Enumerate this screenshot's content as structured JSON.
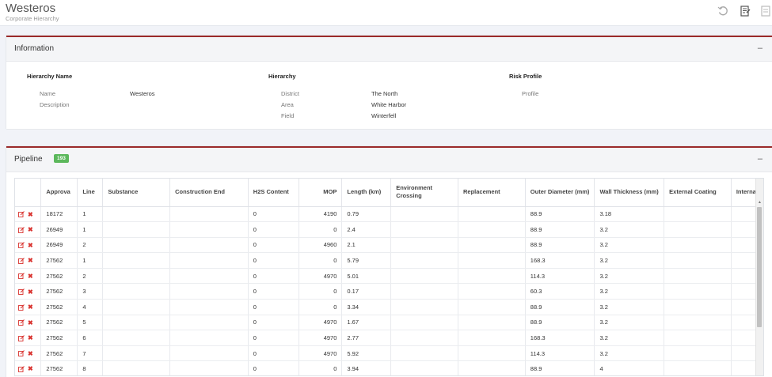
{
  "header": {
    "title": "Westeros",
    "subtitle": "Corporate Hierarchy",
    "icons": [
      "undo-icon",
      "report-icon",
      "export-icon"
    ]
  },
  "info": {
    "title": "Information",
    "collapse": "–",
    "hierarchy_name": {
      "heading": "Hierarchy Name",
      "name_label": "Name",
      "name_value": "Westeros",
      "description_label": "Description"
    },
    "hierarchy": {
      "heading": "Hierarchy",
      "district_label": "District",
      "district_value": "The North",
      "area_label": "Area",
      "area_value": "White Harbor",
      "field_label": "Field",
      "field_value": "Winterfell"
    },
    "risk": {
      "heading": "Risk Profile",
      "profile_label": "Profile"
    }
  },
  "pipeline": {
    "title": "Pipeline",
    "count": "193",
    "collapse": "–",
    "columns": [
      "Approva",
      "Line",
      "Substance",
      "Construction End",
      "H2S Content",
      "MOP",
      "Length (km)",
      "Environment Crossing",
      "Replacement",
      "Outer Diameter (mm)",
      "Wall Thickness (mm)",
      "External Coating",
      "Internal"
    ],
    "rows": [
      [
        "18172",
        "1",
        "",
        "",
        "0",
        "4190",
        "0.79",
        "",
        "",
        "88.9",
        "3.18",
        "",
        ""
      ],
      [
        "26949",
        "1",
        "",
        "",
        "0",
        "0",
        "2.4",
        "",
        "",
        "88.9",
        "3.2",
        "",
        ""
      ],
      [
        "26949",
        "2",
        "",
        "",
        "0",
        "4960",
        "2.1",
        "",
        "",
        "88.9",
        "3.2",
        "",
        ""
      ],
      [
        "27562",
        "1",
        "",
        "",
        "0",
        "0",
        "5.79",
        "",
        "",
        "168.3",
        "3.2",
        "",
        ""
      ],
      [
        "27562",
        "2",
        "",
        "",
        "0",
        "4970",
        "5.01",
        "",
        "",
        "114.3",
        "3.2",
        "",
        ""
      ],
      [
        "27562",
        "3",
        "",
        "",
        "0",
        "0",
        "0.17",
        "",
        "",
        "60.3",
        "3.2",
        "",
        ""
      ],
      [
        "27562",
        "4",
        "",
        "",
        "0",
        "0",
        "3.34",
        "",
        "",
        "88.9",
        "3.2",
        "",
        ""
      ],
      [
        "27562",
        "5",
        "",
        "",
        "0",
        "4970",
        "1.67",
        "",
        "",
        "88.9",
        "3.2",
        "",
        ""
      ],
      [
        "27562",
        "6",
        "",
        "",
        "0",
        "4970",
        "2.77",
        "",
        "",
        "168.3",
        "3.2",
        "",
        ""
      ],
      [
        "27562",
        "7",
        "",
        "",
        "0",
        "4970",
        "5.92",
        "",
        "",
        "114.3",
        "3.2",
        "",
        ""
      ],
      [
        "27562",
        "8",
        "",
        "",
        "0",
        "0",
        "3.94",
        "",
        "",
        "88.9",
        "4",
        "",
        ""
      ]
    ]
  },
  "colors": {
    "accent": "#9b2a2a",
    "badge": "#5cb85c",
    "delete": "#d9322e",
    "edit": "#d9322e"
  }
}
